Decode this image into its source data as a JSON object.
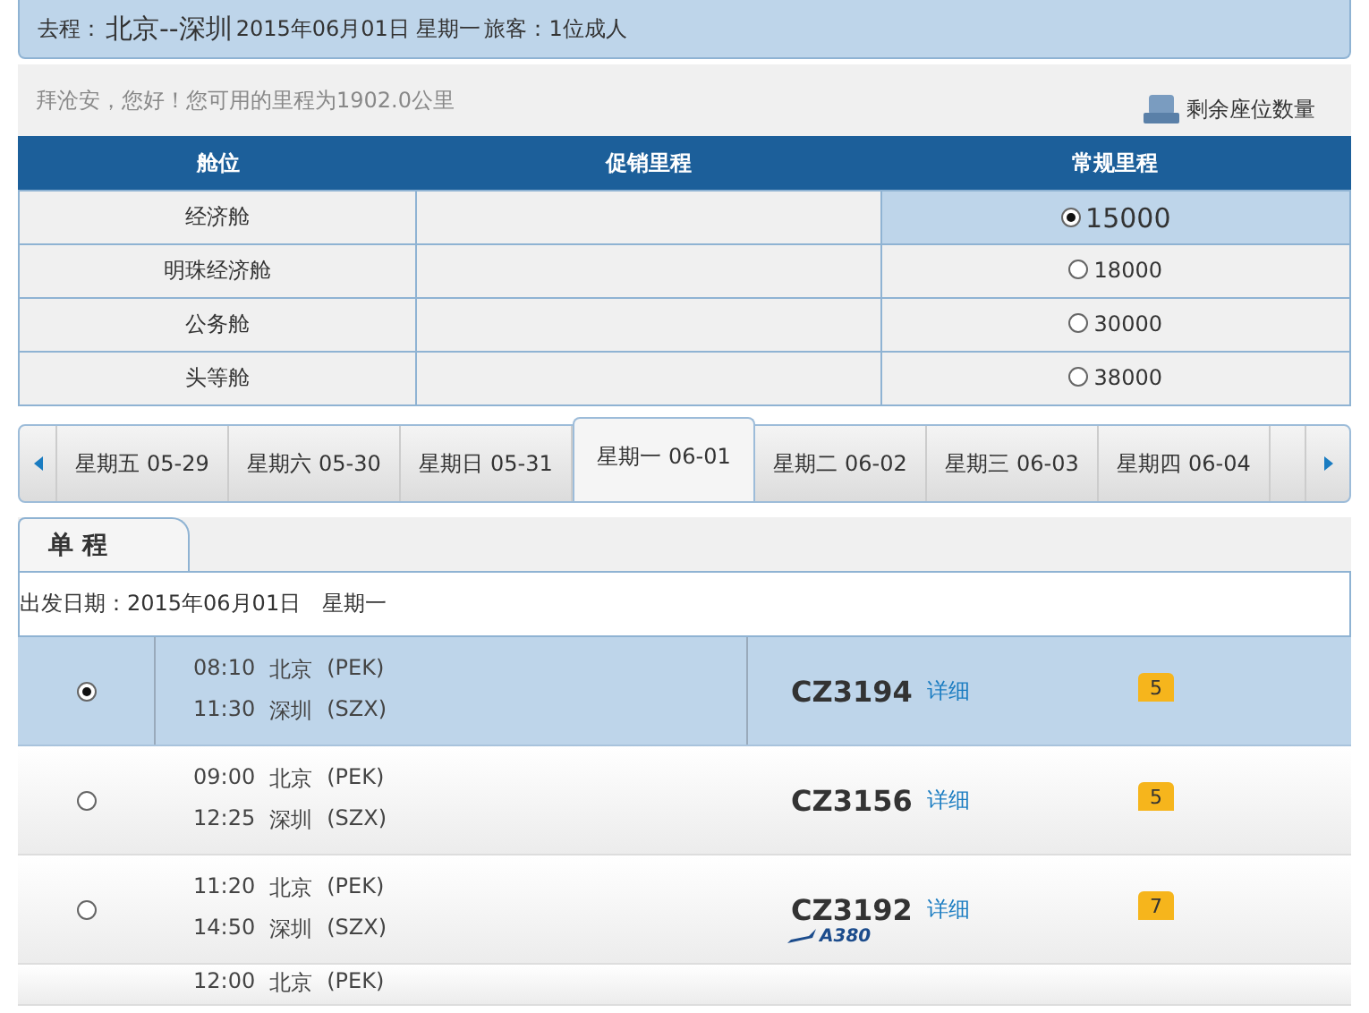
{
  "trip_header": {
    "label": "去程：",
    "route": "北京--深圳",
    "date": "2015年06月01日 星期一",
    "passengers": "旅客：1位成人"
  },
  "greeting": "拜沧安，您好！您可用的里程为1902.0公里",
  "seat_legend": "剩余座位数量",
  "cabin_table": {
    "columns": [
      "舱位",
      "促销里程",
      "常规里程"
    ],
    "rows": [
      {
        "cabin": "经济舱",
        "regular": "15000",
        "selected": true
      },
      {
        "cabin": "明珠经济舱",
        "regular": "18000",
        "selected": false
      },
      {
        "cabin": "公务舱",
        "regular": "30000",
        "selected": false
      },
      {
        "cabin": "头等舱",
        "regular": "38000",
        "selected": false
      }
    ]
  },
  "date_tabs": [
    {
      "label": "星期五 05-29",
      "selected": false
    },
    {
      "label": "星期六 05-30",
      "selected": false
    },
    {
      "label": "星期日 05-31",
      "selected": false
    },
    {
      "label": "星期一 06-01",
      "selected": true
    },
    {
      "label": "星期二 06-02",
      "selected": false
    },
    {
      "label": "星期三 06-03",
      "selected": false
    },
    {
      "label": "星期四 06-04",
      "selected": false
    }
  ],
  "trip_tab": {
    "label": "单 程",
    "selected": true
  },
  "departure_date": "出发日期：2015年06月01日　星期一",
  "flights": [
    {
      "selected": true,
      "dep_time": "08:10",
      "dep_city": "北京",
      "dep_code": "(PEK)",
      "arr_time": "11:30",
      "arr_city": "深圳",
      "arr_code": "(SZX)",
      "number": "CZ3194",
      "details": "详细",
      "seats": "5"
    },
    {
      "selected": false,
      "dep_time": "09:00",
      "dep_city": "北京",
      "dep_code": "(PEK)",
      "arr_time": "12:25",
      "arr_city": "深圳",
      "arr_code": "(SZX)",
      "number": "CZ3156",
      "details": "详细",
      "seats": "5"
    },
    {
      "selected": false,
      "dep_time": "11:20",
      "dep_city": "北京",
      "dep_code": "(PEK)",
      "arr_time": "14:50",
      "arr_city": "深圳",
      "arr_code": "(SZX)",
      "number": "CZ3192",
      "details": "详细",
      "seats": "7",
      "aircraft": "A380"
    },
    {
      "dep_time": "12:00",
      "dep_city": "北京",
      "dep_code": "(PEK)"
    }
  ]
}
